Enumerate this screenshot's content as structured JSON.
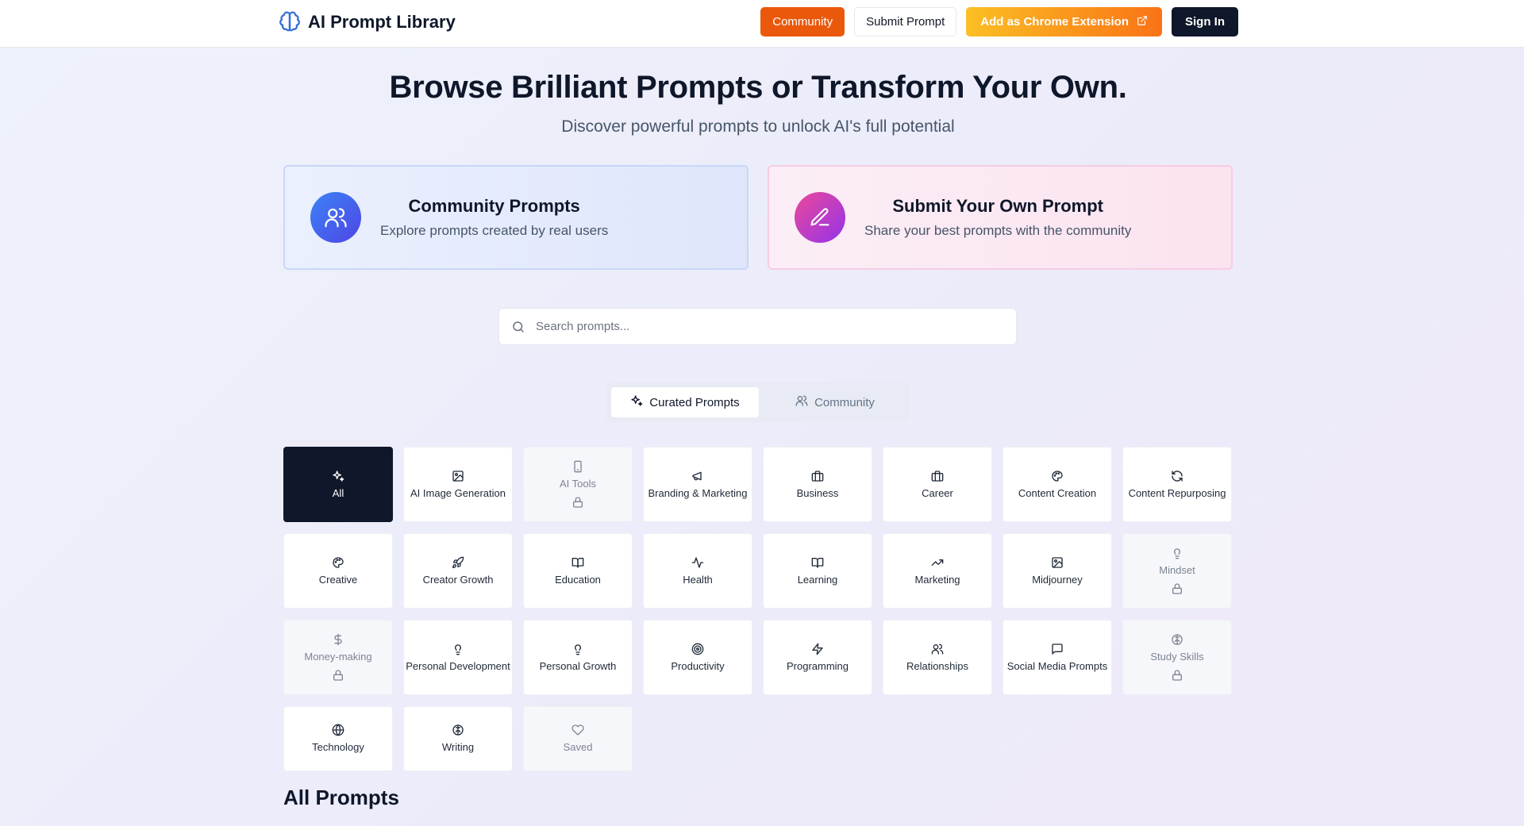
{
  "header": {
    "title": "AI Prompt Library",
    "nav": {
      "community": "Community",
      "submit": "Submit Prompt",
      "chrome": "Add as Chrome Extension",
      "signin": "Sign In"
    }
  },
  "hero": {
    "title": "Browse Brilliant Prompts or Transform Your Own.",
    "subtitle": "Discover powerful prompts to unlock AI's full potential"
  },
  "features": {
    "community": {
      "title": "Community Prompts",
      "desc": "Explore prompts created by real users"
    },
    "submit": {
      "title": "Submit Your Own Prompt",
      "desc": "Share your best prompts with the community"
    }
  },
  "search": {
    "placeholder": "Search prompts..."
  },
  "tabs": {
    "curated": "Curated Prompts",
    "community": "Community"
  },
  "categories": [
    {
      "label": "All",
      "icon": "sparkles-icon",
      "state": "selected"
    },
    {
      "label": "AI Image Generation",
      "icon": "image-icon",
      "state": "normal"
    },
    {
      "label": "AI Tools",
      "icon": "phone-icon",
      "state": "locked"
    },
    {
      "label": "Branding & Marketing",
      "icon": "megaphone-icon",
      "state": "normal"
    },
    {
      "label": "Business",
      "icon": "briefcase-icon",
      "state": "normal"
    },
    {
      "label": "Career",
      "icon": "briefcase-icon",
      "state": "normal"
    },
    {
      "label": "Content Creation",
      "icon": "palette-icon",
      "state": "normal"
    },
    {
      "label": "Content Repurposing",
      "icon": "refresh-icon",
      "state": "normal"
    },
    {
      "label": "Creative",
      "icon": "palette-icon",
      "state": "normal"
    },
    {
      "label": "Creator Growth",
      "icon": "rocket-icon",
      "state": "normal"
    },
    {
      "label": "Education",
      "icon": "book-icon",
      "state": "normal"
    },
    {
      "label": "Health",
      "icon": "activity-icon",
      "state": "normal"
    },
    {
      "label": "Learning",
      "icon": "book-icon",
      "state": "normal"
    },
    {
      "label": "Marketing",
      "icon": "trending-up-icon",
      "state": "normal"
    },
    {
      "label": "Midjourney",
      "icon": "image-icon",
      "state": "normal"
    },
    {
      "label": "Mindset",
      "icon": "lightbulb-icon",
      "state": "locked"
    },
    {
      "label": "Money-making",
      "icon": "dollar-icon",
      "state": "locked"
    },
    {
      "label": "Personal Development",
      "icon": "lightbulb-icon",
      "state": "normal"
    },
    {
      "label": "Personal Growth",
      "icon": "lightbulb-icon",
      "state": "normal"
    },
    {
      "label": "Productivity",
      "icon": "target-icon",
      "state": "normal"
    },
    {
      "label": "Programming",
      "icon": "zap-icon",
      "state": "normal"
    },
    {
      "label": "Relationships",
      "icon": "users-icon",
      "state": "normal"
    },
    {
      "label": "Social Media Prompts",
      "icon": "message-icon",
      "state": "normal"
    },
    {
      "label": "Study Skills",
      "icon": "brain-icon",
      "state": "locked"
    },
    {
      "label": "Technology",
      "icon": "globe-icon",
      "state": "normal"
    },
    {
      "label": "Writing",
      "icon": "brain-icon",
      "state": "normal"
    },
    {
      "label": "Saved",
      "icon": "heart-icon",
      "state": "muted"
    }
  ],
  "section": {
    "title": "All Prompts"
  },
  "colors": {
    "community_button": "#ea580c",
    "chrome_gradient_start": "#fbbf24",
    "chrome_gradient_end": "#f97316",
    "signin": "#0f172a",
    "selected_category": "#0f172a"
  }
}
